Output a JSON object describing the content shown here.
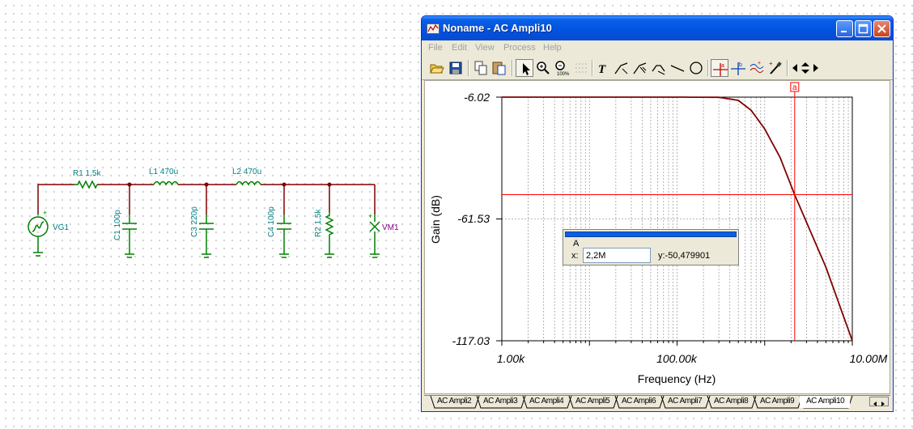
{
  "schematic": {
    "components": {
      "vg1": "VG1",
      "r1": "R1 1,5k",
      "l1": "L1 470u",
      "l2": "L2 470u",
      "c1": "C1 100p",
      "c3": "C3 220p",
      "c4": "C4 100p",
      "r2": "R2 1,5k",
      "vm1": "VM1"
    },
    "colors": {
      "wire": "#800000",
      "component": "#008000",
      "label": "#008080",
      "meter_label": "#800080"
    }
  },
  "window": {
    "title": "Noname - AC Ampli10",
    "menu": [
      "File",
      "Edit",
      "View",
      "Process",
      "Help"
    ],
    "toolbar_icons": [
      "open-folder-icon",
      "save-icon",
      "copy-icon",
      "paste-icon",
      "pointer-icon",
      "zoom-in-icon",
      "zoom-100-icon",
      "grid-icon",
      "text-icon",
      "trace-icon-1",
      "trace-icon-2",
      "trace-icon-3",
      "line-icon",
      "circle-icon",
      "cursor-a-icon",
      "cursor-b-icon",
      "waveform-icon",
      "probe-icon",
      "arrow-left-icon",
      "arrow-updown-icon",
      "arrow-right-icon"
    ]
  },
  "plot": {
    "marker_label": "a",
    "y_ticks": [
      "-6.02",
      "-61.53",
      "-117.03"
    ],
    "x_ticks": [
      "1.00k",
      "100.00k",
      "10.00M"
    ],
    "xlabel": "Frequency (Hz)",
    "ylabel": "Gain (dB)",
    "colors": {
      "curve": "#800000",
      "cursor": "#ff0000",
      "grid": "#a0a0a0"
    }
  },
  "chart_data": {
    "type": "line",
    "x_scale": "log",
    "xlim": [
      1000,
      10000000
    ],
    "ylim": [
      -117.03,
      -6.02
    ],
    "series": [
      {
        "x": [
          1000,
          10000,
          100000,
          300000,
          500000,
          700000,
          1000000,
          1500000,
          2200000,
          3000000,
          5000000,
          10000000
        ],
        "y": [
          -6.02,
          -6.02,
          -6.02,
          -6.1,
          -7.5,
          -12.0,
          -20.5,
          -33.5,
          -50.48,
          -63.0,
          -83.5,
          -117.03
        ]
      }
    ],
    "cursor": {
      "x": 2200000,
      "y": -50.479901
    }
  },
  "cursor_panel": {
    "name": "A",
    "x_label": "x:",
    "x_value": "2,2M",
    "y_text": "y:-50,479901"
  },
  "tabs": [
    "AC Ampli2",
    "AC Ampli3",
    "AC Ampli4",
    "AC Ampli5",
    "AC Ampli6",
    "AC Ampli7",
    "AC Ampli8",
    "AC Ampli9",
    "AC Ampli10"
  ],
  "active_tab": "AC Ampli10"
}
